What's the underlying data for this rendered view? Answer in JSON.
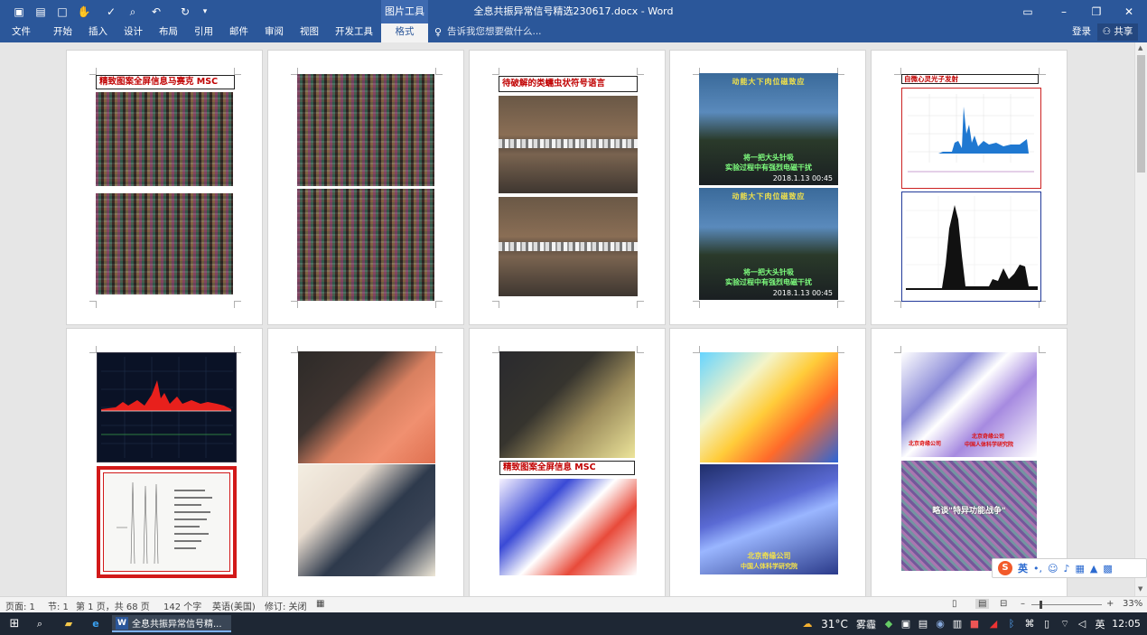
{
  "window": {
    "title": "全息共振异常信号精选230617.docx - Word",
    "context_tab_group": "图片工具",
    "buttons": {
      "ribbon_display": "▭",
      "minimize": "–",
      "restore": "❐",
      "close": "✕"
    }
  },
  "quick_access": {
    "save_icon": "save-icon",
    "open_icon": "open-icon",
    "new_icon": "new-document-icon",
    "touch_icon": "touch-mode-icon",
    "spelling_icon": "spelling-icon",
    "print_preview_icon": "print-preview-icon",
    "undo_icon": "undo-icon",
    "redo_icon": "redo-icon",
    "more_icon": "customize-icon"
  },
  "ribbon": {
    "tabs": [
      "文件",
      "开始",
      "插入",
      "设计",
      "布局",
      "引用",
      "邮件",
      "审阅",
      "视图",
      "开发工具"
    ],
    "context_tab": "格式",
    "tell_me": "告诉我您想要做什么...",
    "sign_in": "登录",
    "share": "共享"
  },
  "pages": [
    {
      "id": "p1",
      "caption": "精致图案全屏信息马赛克 MSC"
    },
    {
      "id": "p2"
    },
    {
      "id": "p3",
      "caption": "待破解的类蠕虫状符号语言"
    },
    {
      "id": "p4",
      "tv_top": "动能大下肉位磁致应",
      "tv_line1": "将一把大头针吸",
      "tv_line2": "实验过程中有强烈电磁干扰",
      "tv_date": "2018.1.13 00:45"
    },
    {
      "id": "p5",
      "caption": "自微心灵光子发射"
    },
    {
      "id": "p6"
    },
    {
      "id": "p7"
    },
    {
      "id": "p8",
      "caption": "精致图案全屏信息 MSC"
    },
    {
      "id": "p9",
      "label_line1": "北京奇缘公司",
      "label_line2": "中国人体科学研究院"
    },
    {
      "id": "p10",
      "label_left": "北京奇缘公司",
      "label_right1": "北京奇缘公司",
      "label_right2": "中国人体科学研究院",
      "banner": "略谈\"特异功能战争\""
    }
  ],
  "statusbar": {
    "page": "页面: 1",
    "section": "节: 1",
    "page_of": "第 1 页，共 68 页",
    "words": "142 个字",
    "language": "英语(美国)",
    "track_changes": "修订: 关闭",
    "zoom": "33%"
  },
  "taskbar": {
    "app_label": "全息共振异常信号精...",
    "temperature": "31°C",
    "weather": "雾霾",
    "ime": "英",
    "time": "12:05"
  },
  "ime_bar": {
    "lang": "英"
  },
  "colors": {
    "word_blue": "#2b579a",
    "caption_red": "#c00000",
    "frame_red": "#d21919"
  }
}
